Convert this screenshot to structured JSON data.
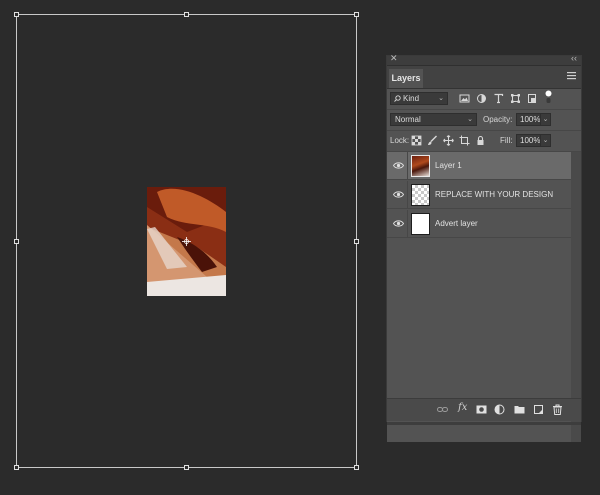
{
  "panel": {
    "tab_label": "Layers",
    "kind_filter": "Kind",
    "blend_mode": "Normal",
    "opacity_label": "Opacity:",
    "opacity_value": "100%",
    "lock_label": "Lock:",
    "fill_label": "Fill:",
    "fill_value": "100%"
  },
  "layers": [
    {
      "name": "Layer 1",
      "selected": true,
      "thumbnail": "photo"
    },
    {
      "name": "REPLACE WITH YOUR DESIGN",
      "selected": false,
      "thumbnail": "transparent"
    },
    {
      "name": "Advert layer",
      "selected": false,
      "thumbnail": "white"
    }
  ],
  "icons": {
    "filter_icons": [
      "image-filter-icon",
      "adjustment-filter-icon",
      "type-filter-icon",
      "shape-filter-icon",
      "smart-object-filter-icon"
    ],
    "lock_icons": [
      "lock-transparent-pixels-icon",
      "lock-image-pixels-icon",
      "lock-position-icon",
      "lock-artboard-icon",
      "lock-all-icon"
    ],
    "bottom_icons": [
      "link-layers-icon",
      "fx-icon",
      "add-mask-icon",
      "adjustment-layer-icon",
      "new-group-icon",
      "new-layer-icon",
      "trash-icon"
    ]
  }
}
